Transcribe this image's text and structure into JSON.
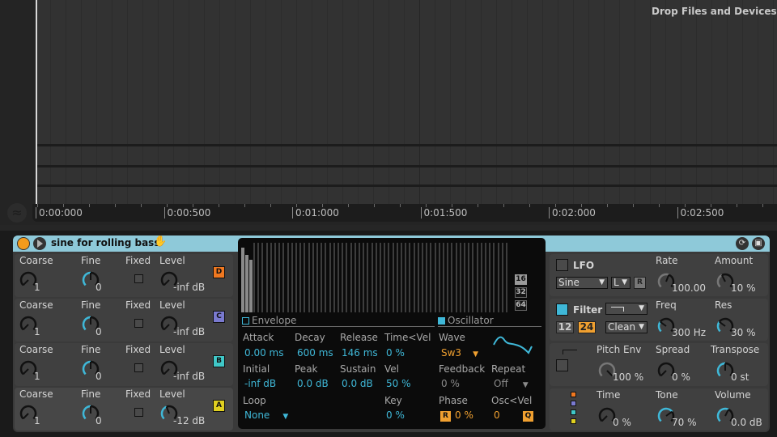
{
  "arrangement": {
    "drop_hint": "Drop Files and Devices Here",
    "ruler_labels": [
      "0:00:000",
      "0:00:500",
      "0:01:000",
      "0:01:500",
      "0:02:000",
      "0:02:500"
    ]
  },
  "device": {
    "name": "sine for rolling bass",
    "operators": [
      {
        "id": "D",
        "coarse_label": "Coarse",
        "coarse": "1",
        "fine_label": "Fine",
        "fine": "0",
        "fixed_label": "Fixed",
        "level_label": "Level",
        "level": "-inf dB",
        "color": "#f07820"
      },
      {
        "id": "C",
        "coarse_label": "Coarse",
        "coarse": "1",
        "fine_label": "Fine",
        "fine": "0",
        "fixed_label": "Fixed",
        "level_label": "Level",
        "level": "-inf dB",
        "color": "#7a7ad0"
      },
      {
        "id": "B",
        "coarse_label": "Coarse",
        "coarse": "1",
        "fine_label": "Fine",
        "fine": "0",
        "fixed_label": "Fixed",
        "level_label": "Level",
        "level": "-inf dB",
        "color": "#40c8c8"
      },
      {
        "id": "A",
        "coarse_label": "Coarse",
        "coarse": "1",
        "fine_label": "Fine",
        "fine": "0",
        "fixed_label": "Fixed",
        "level_label": "Level",
        "level": "-12 dB",
        "color": "#e0d020"
      }
    ],
    "display": {
      "harmonics_active": [
        0.93,
        0.82,
        0.76
      ],
      "size_buttons": [
        "16",
        "32",
        "64"
      ],
      "size_selected": "16",
      "envelope_header": "Envelope",
      "oscillator_header": "Oscillator",
      "envelope": {
        "attack_label": "Attack",
        "attack": "0.00 ms",
        "decay_label": "Decay",
        "decay": "600 ms",
        "release_label": "Release",
        "release": "146 ms",
        "timevel_label": "Time<Vel",
        "timevel": "0 %",
        "initial_label": "Initial",
        "initial": "-inf dB",
        "peak_label": "Peak",
        "peak": "0.0 dB",
        "sustain_label": "Sustain",
        "sustain": "0.0 dB",
        "vel_label": "Vel",
        "vel": "50 %",
        "loop_label": "Loop",
        "loop": "None",
        "key_label": "Key",
        "key": "0 %"
      },
      "oscillator": {
        "wave_label": "Wave",
        "wave": "Sw3",
        "feedback_label": "Feedback",
        "feedback": "0 %",
        "repeat_label": "Repeat",
        "repeat": "Off",
        "phase_label": "Phase",
        "phase_btn": "R",
        "phase": "0 %",
        "oscvel_label": "Osc<Vel",
        "oscvel": "0",
        "oscvel_btn": "Q"
      }
    },
    "lfo": {
      "label": "LFO",
      "wave": "Sine",
      "range": "L",
      "retrig": "R",
      "rate_label": "Rate",
      "rate": "100.00",
      "amount_label": "Amount",
      "amount": "10 %"
    },
    "filter": {
      "label": "Filter",
      "slope_12": "12",
      "slope_24": "24",
      "slope_selected": "24",
      "circuit": "Clean",
      "freq_label": "Freq",
      "freq": "300 Hz",
      "res_label": "Res",
      "res": "30 %"
    },
    "pitch": {
      "pitchenv_label": "Pitch Env",
      "pitchenv": "100 %",
      "spread_label": "Spread",
      "spread": "0 %",
      "transpose_label": "Transpose",
      "transpose": "0 st"
    },
    "global": {
      "time_label": "Time",
      "time": "0 %",
      "tone_label": "Tone",
      "tone": "70 %",
      "volume_label": "Volume",
      "volume": "0.0 dB"
    },
    "accent_color": "#3fb8d8",
    "title_color": "#8ec9d9"
  }
}
